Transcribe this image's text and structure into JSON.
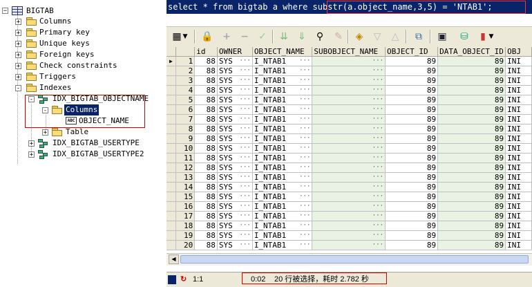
{
  "tree": {
    "root": "BIGTAB",
    "nodes": [
      {
        "label": "Columns",
        "expander": "+"
      },
      {
        "label": "Primary key",
        "expander": "+"
      },
      {
        "label": "Unique keys",
        "expander": "+"
      },
      {
        "label": "Foreign keys",
        "expander": "+"
      },
      {
        "label": "Check constraints",
        "expander": "+"
      },
      {
        "label": "Triggers",
        "expander": "+"
      },
      {
        "label": "Indexes",
        "expander": "-"
      }
    ],
    "indexes": [
      {
        "label": "IDX_BIGTAB_OBJECTNAME",
        "expander": "-"
      },
      {
        "label": "IDX_BIGTAB_USERTYPE",
        "expander": "+"
      },
      {
        "label": "IDX_BIGTAB_USERTYPE2",
        "expander": "+"
      }
    ],
    "index_children": {
      "columns_label": "Columns",
      "columns_expander": "-",
      "column_item": "OBJECT_NAME",
      "column_icon_text": "ABC",
      "table_label": "Table",
      "table_expander": "+"
    }
  },
  "sql": {
    "text": "select * from bigtab a where substr(a.object_name,3,5) = 'NTAB1';"
  },
  "toolbar": {
    "icons": [
      "grid-menu-icon",
      "lock-icon",
      "add-icon",
      "remove-icon",
      "post-icon",
      "fetch-next-icon",
      "fetch-last-icon",
      "find-icon",
      "clear-icon",
      "query-icon",
      "filter-down-icon",
      "filter-up-icon",
      "chart-icon",
      "save-icon",
      "export-icon",
      "bar-chart-icon"
    ]
  },
  "grid": {
    "columns": [
      "id",
      "OWNER",
      "OBJECT_NAME",
      "SUBOBJECT_NAME",
      "OBJECT_ID",
      "DATA_OBJECT_ID",
      "OBJ"
    ],
    "row_indicator": "▶",
    "rows": [
      {
        "rn": "1",
        "id": "88",
        "owner": "SYS",
        "name": "I_NTAB1",
        "sub": "",
        "oid": "89",
        "doid": "89",
        "obj": "INI"
      },
      {
        "rn": "2",
        "id": "88",
        "owner": "SYS",
        "name": "I_NTAB1",
        "sub": "",
        "oid": "89",
        "doid": "89",
        "obj": "INI"
      },
      {
        "rn": "3",
        "id": "88",
        "owner": "SYS",
        "name": "I_NTAB1",
        "sub": "",
        "oid": "89",
        "doid": "89",
        "obj": "INI"
      },
      {
        "rn": "4",
        "id": "88",
        "owner": "SYS",
        "name": "I_NTAB1",
        "sub": "",
        "oid": "89",
        "doid": "89",
        "obj": "INI"
      },
      {
        "rn": "5",
        "id": "88",
        "owner": "SYS",
        "name": "I_NTAB1",
        "sub": "",
        "oid": "89",
        "doid": "89",
        "obj": "INI"
      },
      {
        "rn": "6",
        "id": "88",
        "owner": "SYS",
        "name": "I_NTAB1",
        "sub": "",
        "oid": "89",
        "doid": "89",
        "obj": "INI"
      },
      {
        "rn": "7",
        "id": "88",
        "owner": "SYS",
        "name": "I_NTAB1",
        "sub": "",
        "oid": "89",
        "doid": "89",
        "obj": "INI"
      },
      {
        "rn": "8",
        "id": "88",
        "owner": "SYS",
        "name": "I_NTAB1",
        "sub": "",
        "oid": "89",
        "doid": "89",
        "obj": "INI"
      },
      {
        "rn": "9",
        "id": "88",
        "owner": "SYS",
        "name": "I_NTAB1",
        "sub": "",
        "oid": "89",
        "doid": "89",
        "obj": "INI"
      },
      {
        "rn": "10",
        "id": "88",
        "owner": "SYS",
        "name": "I_NTAB1",
        "sub": "",
        "oid": "89",
        "doid": "89",
        "obj": "INI"
      },
      {
        "rn": "11",
        "id": "88",
        "owner": "SYS",
        "name": "I_NTAB1",
        "sub": "",
        "oid": "89",
        "doid": "89",
        "obj": "INI"
      },
      {
        "rn": "12",
        "id": "88",
        "owner": "SYS",
        "name": "I_NTAB1",
        "sub": "",
        "oid": "89",
        "doid": "89",
        "obj": "INI"
      },
      {
        "rn": "13",
        "id": "88",
        "owner": "SYS",
        "name": "I_NTAB1",
        "sub": "",
        "oid": "89",
        "doid": "89",
        "obj": "INI"
      },
      {
        "rn": "14",
        "id": "88",
        "owner": "SYS",
        "name": "I_NTAB1",
        "sub": "",
        "oid": "89",
        "doid": "89",
        "obj": "INI"
      },
      {
        "rn": "15",
        "id": "88",
        "owner": "SYS",
        "name": "I_NTAB1",
        "sub": "",
        "oid": "89",
        "doid": "89",
        "obj": "INI"
      },
      {
        "rn": "16",
        "id": "88",
        "owner": "SYS",
        "name": "I_NTAB1",
        "sub": "",
        "oid": "89",
        "doid": "89",
        "obj": "INI"
      },
      {
        "rn": "17",
        "id": "88",
        "owner": "SYS",
        "name": "I_NTAB1",
        "sub": "",
        "oid": "89",
        "doid": "89",
        "obj": "INI"
      },
      {
        "rn": "18",
        "id": "88",
        "owner": "SYS",
        "name": "I_NTAB1",
        "sub": "",
        "oid": "89",
        "doid": "89",
        "obj": "INI"
      },
      {
        "rn": "19",
        "id": "88",
        "owner": "SYS",
        "name": "I_NTAB1",
        "sub": "",
        "oid": "89",
        "doid": "89",
        "obj": "INI"
      },
      {
        "rn": "20",
        "id": "88",
        "owner": "SYS",
        "name": "I_NTAB1",
        "sub": "",
        "oid": "89",
        "doid": "89",
        "obj": "INI"
      }
    ]
  },
  "statusbar": {
    "position": "1:1",
    "elapsed": "0:02",
    "message": "20 行被选择，耗时 2.782 秒"
  },
  "colors": {
    "sql_background": "#0a246a",
    "highlight_box": "#d00000",
    "green_column": "#e8f3e4",
    "chrome": "#ece9d8"
  }
}
